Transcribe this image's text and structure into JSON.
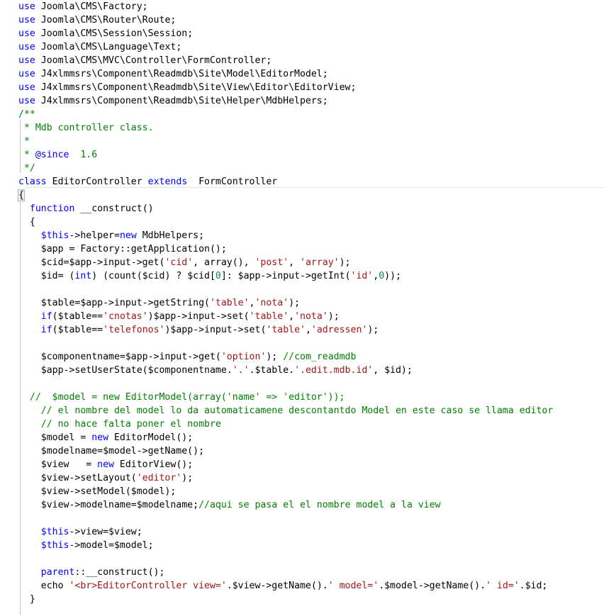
{
  "editor": {
    "colors": {
      "keyword": "#0000ff",
      "comment": "#008000",
      "string": "#a31515",
      "number": "#098658",
      "text": "#000000",
      "background": "#ffffff"
    },
    "lines": [
      [
        {
          "t": "use",
          "c": "kw"
        },
        {
          "t": " Joomla\\CMS\\Factory;"
        }
      ],
      [
        {
          "t": "use",
          "c": "kw"
        },
        {
          "t": " Joomla\\CMS\\Router\\Route;"
        }
      ],
      [
        {
          "t": "use",
          "c": "kw"
        },
        {
          "t": " Joomla\\CMS\\Session\\Session;"
        }
      ],
      [
        {
          "t": "use",
          "c": "kw"
        },
        {
          "t": " Joomla\\CMS\\Language\\Text;"
        }
      ],
      [
        {
          "t": "use",
          "c": "kw"
        },
        {
          "t": " Joomla\\CMS\\MVC\\Controller\\FormController;"
        }
      ],
      [
        {
          "t": "use",
          "c": "kw"
        },
        {
          "t": " J4xlmmsrs\\Component\\Readmdb\\Site\\Model\\EditorModel;"
        }
      ],
      [
        {
          "t": "use",
          "c": "kw"
        },
        {
          "t": " J4xlmmsrs\\Component\\Readmdb\\Site\\View\\Editor\\EditorView;"
        }
      ],
      [
        {
          "t": "use",
          "c": "kw"
        },
        {
          "t": " J4xlmmsrs\\Component\\Readmdb\\Site\\Helper\\MdbHelpers;"
        }
      ],
      [
        {
          "t": "/**",
          "c": "cmt"
        }
      ],
      [
        {
          "t": " * Mdb controller class.",
          "c": "cmt"
        }
      ],
      [
        {
          "t": " *",
          "c": "cmt"
        }
      ],
      [
        {
          "t": " * ",
          "c": "cmt"
        },
        {
          "t": "@since",
          "c": "kw"
        },
        {
          "t": "  1.6",
          "c": "cmt"
        }
      ],
      [
        {
          "t": " */",
          "c": "cmt"
        }
      ],
      [
        {
          "t": "class",
          "c": "kw"
        },
        {
          "t": " EditorController "
        },
        {
          "t": "extends",
          "c": "kw"
        },
        {
          "t": "  FormController"
        }
      ],
      [
        {
          "t": "{",
          "c": "brace"
        }
      ],
      [
        {
          "t": "  "
        },
        {
          "t": "function",
          "c": "kw"
        },
        {
          "t": " __construct()"
        }
      ],
      [
        {
          "t": "  {"
        }
      ],
      [
        {
          "t": "    "
        },
        {
          "t": "$this",
          "c": "kw"
        },
        {
          "t": "->helper="
        },
        {
          "t": "new",
          "c": "kw"
        },
        {
          "t": " MdbHelpers;"
        }
      ],
      [
        {
          "t": "    $app = Factory::getApplication();"
        }
      ],
      [
        {
          "t": "    $cid=$app->input->get("
        },
        {
          "t": "'cid'",
          "c": "str"
        },
        {
          "t": ", array(), "
        },
        {
          "t": "'post'",
          "c": "str"
        },
        {
          "t": ", "
        },
        {
          "t": "'array'",
          "c": "str"
        },
        {
          "t": ");"
        }
      ],
      [
        {
          "t": "    $id= ("
        },
        {
          "t": "int",
          "c": "kw"
        },
        {
          "t": ") (count($cid) ? $cid["
        },
        {
          "t": "0",
          "c": "num"
        },
        {
          "t": "]: $app->input->getInt("
        },
        {
          "t": "'id'",
          "c": "str"
        },
        {
          "t": ","
        },
        {
          "t": "0",
          "c": "num"
        },
        {
          "t": "));"
        }
      ],
      [
        {
          "t": ""
        }
      ],
      [
        {
          "t": "    $table=$app->input->getString("
        },
        {
          "t": "'table'",
          "c": "str"
        },
        {
          "t": ","
        },
        {
          "t": "'nota'",
          "c": "str"
        },
        {
          "t": ");"
        }
      ],
      [
        {
          "t": "    "
        },
        {
          "t": "if",
          "c": "kw"
        },
        {
          "t": "($table=="
        },
        {
          "t": "'cnotas'",
          "c": "str"
        },
        {
          "t": ")$app->input->set("
        },
        {
          "t": "'table'",
          "c": "str"
        },
        {
          "t": ","
        },
        {
          "t": "'nota'",
          "c": "str"
        },
        {
          "t": ");"
        }
      ],
      [
        {
          "t": "    "
        },
        {
          "t": "if",
          "c": "kw"
        },
        {
          "t": "($table=="
        },
        {
          "t": "'telefonos'",
          "c": "str"
        },
        {
          "t": ")$app->input->set("
        },
        {
          "t": "'table'",
          "c": "str"
        },
        {
          "t": ","
        },
        {
          "t": "'adressen'",
          "c": "str"
        },
        {
          "t": ");"
        }
      ],
      [
        {
          "t": ""
        }
      ],
      [
        {
          "t": "    $componentname=$app->input->get("
        },
        {
          "t": "'option'",
          "c": "str"
        },
        {
          "t": "); "
        },
        {
          "t": "//com_readmdb",
          "c": "cmt"
        }
      ],
      [
        {
          "t": "    $app->setUserState($componentname."
        },
        {
          "t": "'.'",
          "c": "str"
        },
        {
          "t": ".$table."
        },
        {
          "t": "'.edit.mdb.id'",
          "c": "str"
        },
        {
          "t": ", $id);"
        }
      ],
      [
        {
          "t": ""
        }
      ],
      [
        {
          "t": "  //  $model = new EditorModel(array('name' => 'editor'));",
          "c": "cmt"
        }
      ],
      [
        {
          "t": "    "
        },
        {
          "t": "// el nombre del model lo da automaticamene descontantdo Model en este caso se llama editor",
          "c": "cmt"
        }
      ],
      [
        {
          "t": "    "
        },
        {
          "t": "// no hace falta poner el nombre",
          "c": "cmt"
        }
      ],
      [
        {
          "t": "    $model = "
        },
        {
          "t": "new",
          "c": "kw"
        },
        {
          "t": " EditorModel();"
        }
      ],
      [
        {
          "t": "    $modelname=$model->getName();"
        }
      ],
      [
        {
          "t": "    $view   = "
        },
        {
          "t": "new",
          "c": "kw"
        },
        {
          "t": " EditorView();"
        }
      ],
      [
        {
          "t": "    $view->setLayout("
        },
        {
          "t": "'editor'",
          "c": "str"
        },
        {
          "t": ");"
        }
      ],
      [
        {
          "t": "    $view->setModel($model);"
        }
      ],
      [
        {
          "t": "    $view->modelname=$modelname;"
        },
        {
          "t": "//aqui se pasa el el nombre model a la view",
          "c": "cmt"
        }
      ],
      [
        {
          "t": ""
        }
      ],
      [
        {
          "t": "    "
        },
        {
          "t": "$this",
          "c": "kw"
        },
        {
          "t": "->view=$view;"
        }
      ],
      [
        {
          "t": "    "
        },
        {
          "t": "$this",
          "c": "kw"
        },
        {
          "t": "->model=$model;"
        }
      ],
      [
        {
          "t": ""
        }
      ],
      [
        {
          "t": "    "
        },
        {
          "t": "parent",
          "c": "kw"
        },
        {
          "t": "::__construct();"
        }
      ],
      [
        {
          "t": "    echo "
        },
        {
          "t": "'<br>EditorController view='",
          "c": "str"
        },
        {
          "t": ".$view->getName()."
        },
        {
          "t": "' model='",
          "c": "str"
        },
        {
          "t": ".$model->getName()."
        },
        {
          "t": "' id='",
          "c": "str"
        },
        {
          "t": ".$id;"
        }
      ],
      [
        {
          "t": "  }"
        }
      ]
    ]
  }
}
